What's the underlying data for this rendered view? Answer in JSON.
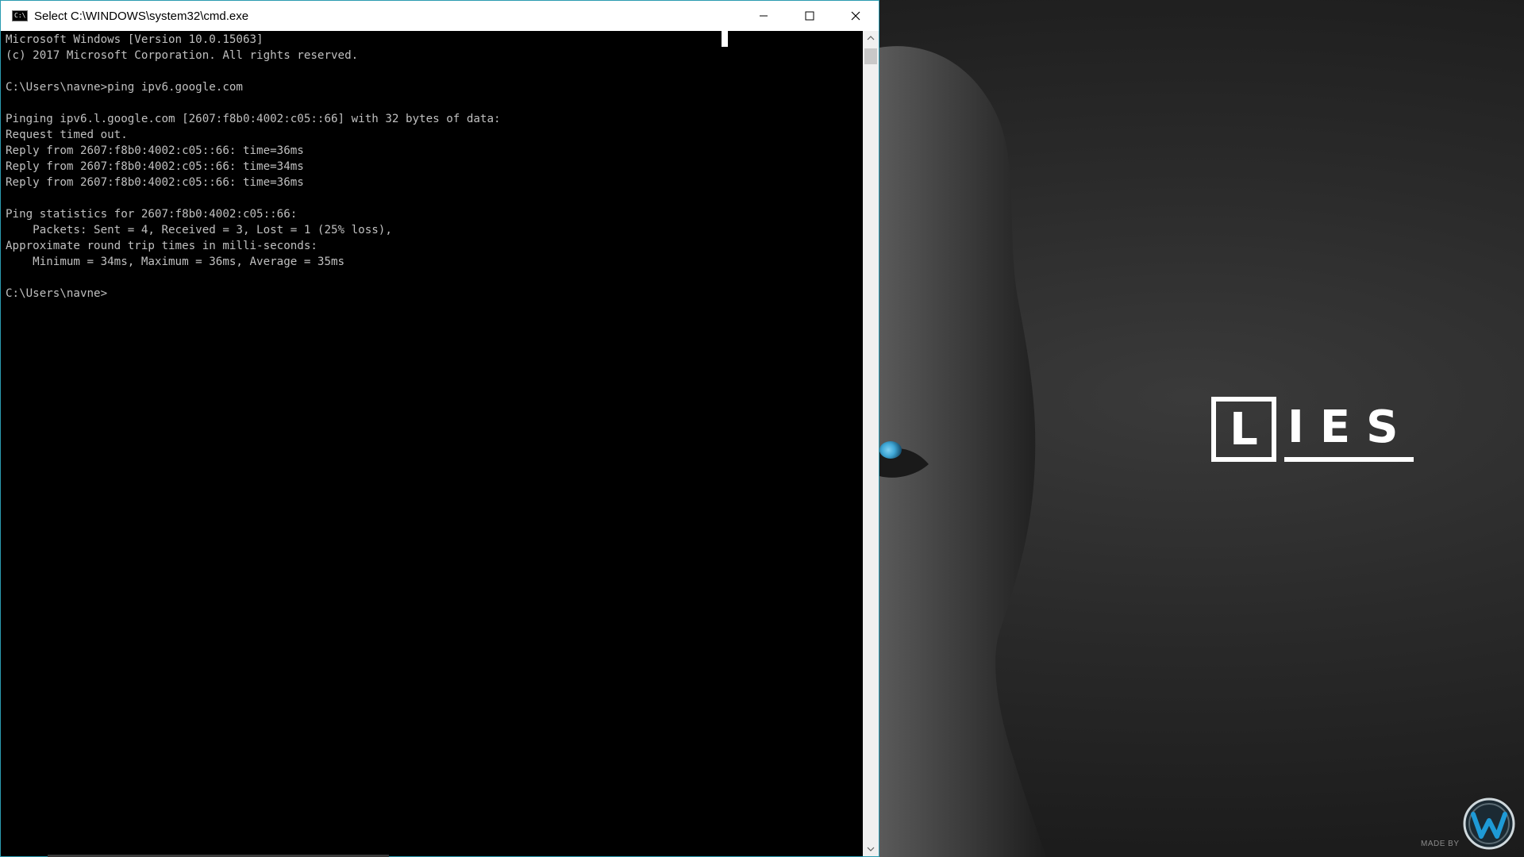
{
  "window": {
    "title": "Select C:\\WINDOWS\\system32\\cmd.exe",
    "icon": "cmd-app-icon",
    "icon_glyph": "C:\\",
    "accent_border": "#2b9bb1",
    "controls": {
      "minimize": "minimize-icon",
      "maximize": "maximize-icon",
      "close": "close-icon"
    }
  },
  "console": {
    "text_color": "#c0c0c0",
    "background": "#000000",
    "lines": [
      "Microsoft Windows [Version 10.0.15063]",
      "(c) 2017 Microsoft Corporation. All rights reserved.",
      "",
      "C:\\Users\\navne>ping ipv6.google.com",
      "",
      "Pinging ipv6.l.google.com [2607:f8b0:4002:c05::66] with 32 bytes of data:",
      "Request timed out.",
      "Reply from 2607:f8b0:4002:c05::66: time=36ms",
      "Reply from 2607:f8b0:4002:c05::66: time=34ms",
      "Reply from 2607:f8b0:4002:c05::66: time=36ms",
      "",
      "Ping statistics for 2607:f8b0:4002:c05::66:",
      "    Packets: Sent = 4, Received = 3, Lost = 1 (25% loss),",
      "Approximate round trip times in milli-seconds:",
      "    Minimum = 34ms, Maximum = 36ms, Average = 35ms",
      "",
      "C:\\Users\\navne>"
    ]
  },
  "wallpaper": {
    "logo_first_letter": "L",
    "logo_rest": "IES",
    "made_by": "MADE BY",
    "eye_color": "#3fa7d6"
  }
}
